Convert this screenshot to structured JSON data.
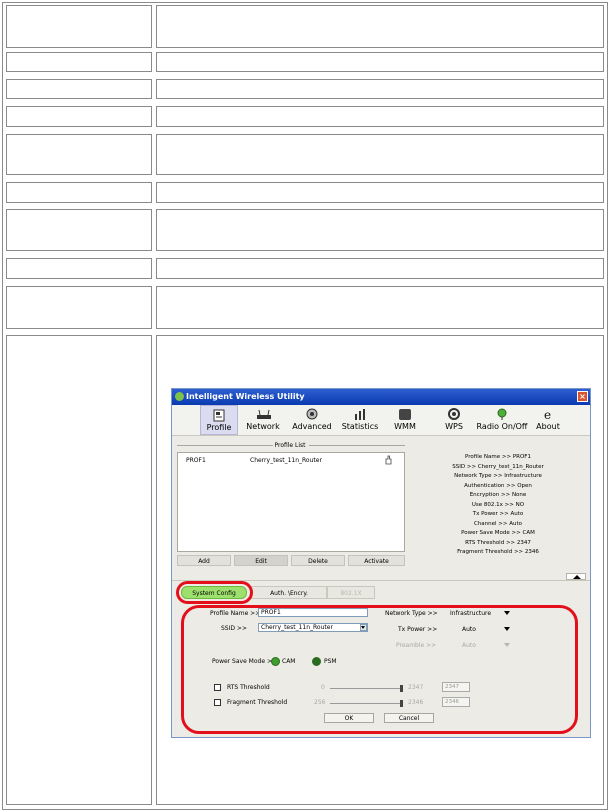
{
  "window": {
    "title": "Intelligent Wireless Utility",
    "close": "×"
  },
  "toolbar": [
    "Profile",
    "Network",
    "Advanced",
    "Statistics",
    "WMM",
    "WPS",
    "Radio On/Off",
    "About"
  ],
  "profile_list": {
    "title": "Profile List",
    "rows": [
      {
        "name": "PROF1",
        "ssid": "Cherry_test_11n_Router"
      }
    ],
    "buttons": [
      "Add",
      "Edit",
      "Delete",
      "Activate"
    ]
  },
  "info": [
    "Profile Name >> PROF1",
    "SSID >> Cherry_test_11n_Router",
    "Network Type >> Infrastructure",
    "Authentication >> Open",
    "Encryption >> None",
    "Use 802.1x >> NO",
    "Tx Power >> Auto",
    "Channel >> Auto",
    "Power Save Mode >> CAM",
    "RTS Threshold >> 2347",
    "Fragment Threshold >> 2346"
  ],
  "tabs": [
    "System Config",
    "Auth. \\Encry.",
    "802.1X"
  ],
  "config": {
    "profile_name_label": "Profile Name >>",
    "profile_name_value": "PROF1",
    "ssid_label": "SSID >>",
    "ssid_value": "Cherry_test_11n_Router",
    "network_type_label": "Network Type >>",
    "network_type_value": "Infrastructure",
    "tx_power_label": "Tx Power >>",
    "tx_power_value": "Auto",
    "preamble_label": "Preamble >>",
    "preamble_value": "Auto",
    "power_save_label": "Power Save Mode >>",
    "cam": "CAM",
    "psm": "PSM",
    "rts_label": "RTS Threshold",
    "rts_min": "0",
    "rts_max": "2347",
    "rts_value": "2347",
    "frag_label": "Fragment Threshold",
    "frag_min": "256",
    "frag_max": "2346",
    "frag_value": "2346",
    "ok": "OK",
    "cancel": "Cancel"
  },
  "colors": {
    "highlight_ring": "#e3101c",
    "tab_active": "#9ee06d",
    "titlebar": "#1a4bc2"
  }
}
